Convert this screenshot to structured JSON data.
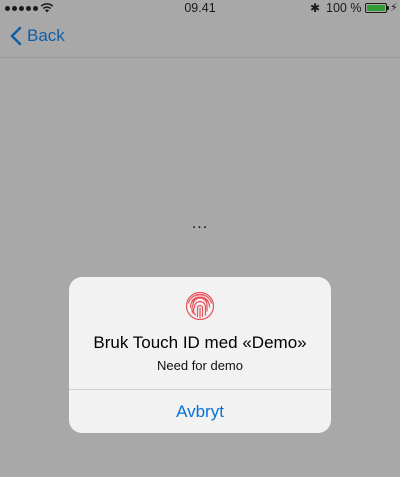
{
  "status_bar": {
    "time": "09.41",
    "battery_percent": "100 %",
    "battery_level": 1.0,
    "battery_color": "#2f9b35",
    "signal_bars": 5,
    "icons": [
      "signal-dots-icon",
      "wifi-icon",
      "bluetooth-icon",
      "battery-icon",
      "charging-icon"
    ]
  },
  "nav": {
    "back_label": "Back",
    "accent_color": "#0e5fa5"
  },
  "content": {
    "loading_text": "..."
  },
  "dialog": {
    "title": "Bruk Touch ID med «Demo»",
    "message": "Need for demo",
    "cancel_label": "Avbryt",
    "icon": "fingerprint-icon",
    "icon_color": "#e8525a"
  }
}
